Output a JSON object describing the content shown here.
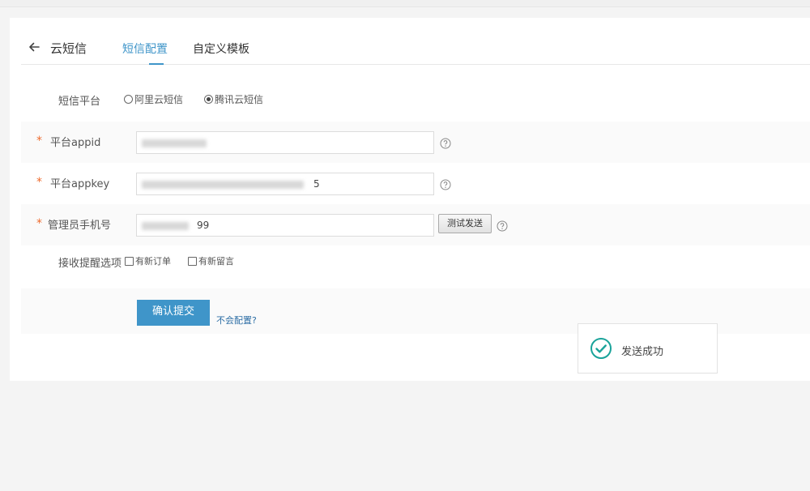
{
  "header": {
    "title": "云短信",
    "tabs": [
      {
        "label": "短信配置",
        "active": true
      },
      {
        "label": "自定义模板",
        "active": false
      }
    ]
  },
  "form": {
    "platform": {
      "label": "短信平台",
      "options": [
        {
          "label": "阿里云短信",
          "checked": false
        },
        {
          "label": "腾讯云短信",
          "checked": true
        }
      ]
    },
    "appid": {
      "label": "平台appid",
      "required_mark": "*",
      "value_visible": ""
    },
    "appkey": {
      "label": "平台appkey",
      "required_mark": "*",
      "value_visible": "5"
    },
    "phone": {
      "label": "管理员手机号",
      "required_mark": "*",
      "value_visible": "99",
      "test_button": "测试发送"
    },
    "notify": {
      "label": "接收提醒选项",
      "options": [
        {
          "label": "有新订单",
          "checked": false
        },
        {
          "label": "有新留言",
          "checked": false
        }
      ]
    },
    "submit_label": "确认提交",
    "help_link": "不会配置?"
  },
  "toast": {
    "text": "发送成功",
    "icon": "check-circle-icon"
  },
  "colors": {
    "accent": "#3f95c9",
    "required": "#ee6b2e",
    "success": "#1aa39a",
    "link": "#2d6ea5"
  }
}
